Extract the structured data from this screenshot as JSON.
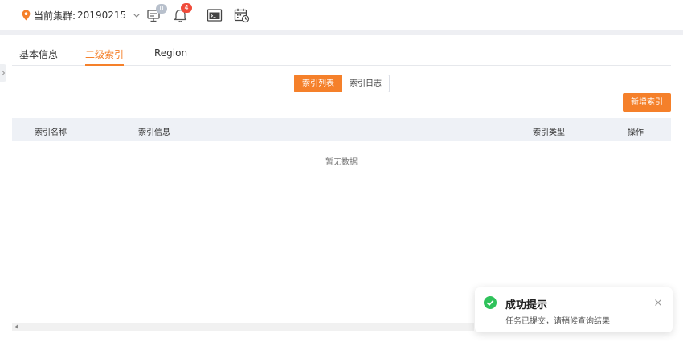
{
  "header": {
    "cluster_label": "当前集群:",
    "cluster_value": "20190215",
    "monitor_badge": "0",
    "bell_badge": "4"
  },
  "tabs": [
    {
      "label": "基本信息",
      "active": false
    },
    {
      "label": "二级索引",
      "active": true
    },
    {
      "label": "Region",
      "active": false
    }
  ],
  "segments": [
    {
      "label": "索引列表",
      "active": true
    },
    {
      "label": "索引日志",
      "active": false
    }
  ],
  "add_button": "新增索引",
  "table": {
    "columns": [
      "索引名称",
      "索引信息",
      "索引类型",
      "操作"
    ],
    "empty_text": "暂无数据"
  },
  "toast": {
    "title": "成功提示",
    "message": "任务已提交，请稍候查询结果"
  },
  "colors": {
    "accent": "#f5802a",
    "success": "#2fc25b",
    "badge_red": "#f04b3a"
  }
}
